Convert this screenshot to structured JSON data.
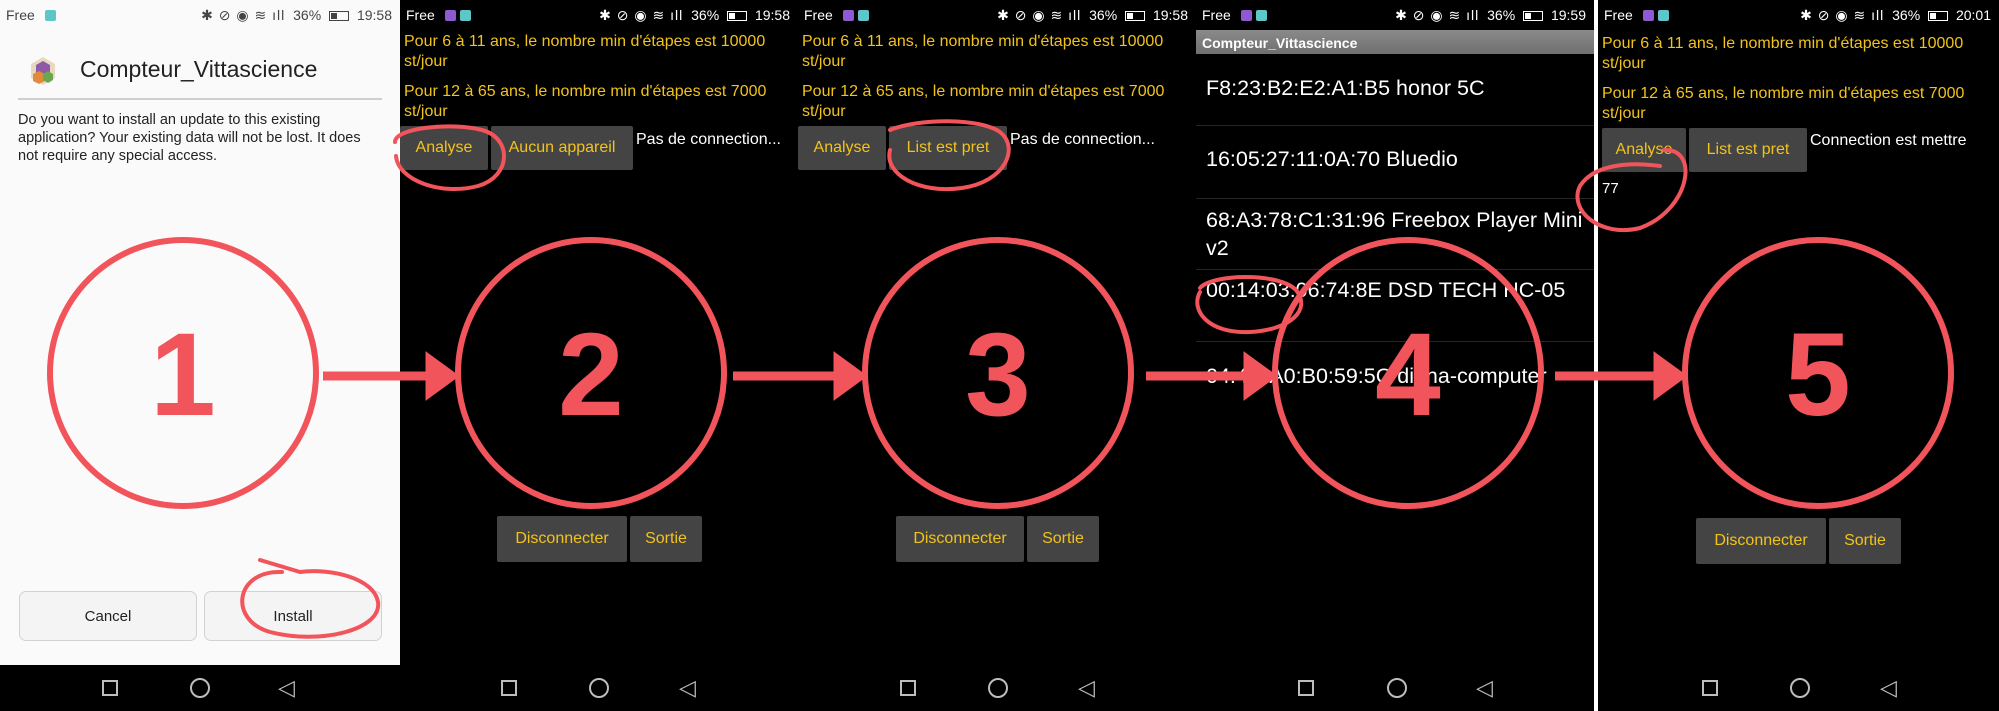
{
  "status_bar": {
    "carrier": "Free",
    "battery": "36%",
    "times": [
      "19:58",
      "19:58",
      "19:58",
      "19:59",
      "20:01"
    ]
  },
  "colors": {
    "accent": "#f2545b",
    "button_text": "#f2c31b",
    "button_bg": "#444444"
  },
  "panel1": {
    "app_name": "Compteur_Vittascience",
    "message": "Do you want to install an update to this existing application? Your existing data will not be lost. It does not require any special access.",
    "cancel": "Cancel",
    "install": "Install"
  },
  "info": {
    "line1": "Pour 6 à 11 ans, le nombre min d'étapes est 10000 st/jour",
    "line2": "Pour 12 à 65 ans, le nombre min d'étapes est 7000 st/jour"
  },
  "panel2": {
    "analyse": "Analyse",
    "device_btn": "Aucun appareil",
    "status": "Pas de connection...",
    "disconnect": "Disconnecter",
    "exit": "Sortie"
  },
  "panel3": {
    "analyse": "Analyse",
    "device_btn": "List est pret",
    "status": "Pas de connection...",
    "disconnect": "Disconnecter",
    "exit": "Sortie"
  },
  "panel4": {
    "title": "Compteur_Vittascience",
    "devices": [
      "F8:23:B2:E2:A1:B5 honor 5C",
      "16:05:27:11:0A:70 Bluedio",
      "68:A3:78:C1:31:96 Freebox Player Mini v2",
      "00:14:03:06:74:8E DSD TECH HC-05",
      "04:4C:A0:B0:59:5C diana-computer"
    ]
  },
  "panel5": {
    "analyse": "Analyse",
    "device_btn": "List est pret",
    "status": "Connection est mettre",
    "steps": "77",
    "disconnect": "Disconnecter",
    "exit": "Sortie"
  },
  "steps": [
    "1",
    "2",
    "3",
    "4",
    "5"
  ]
}
